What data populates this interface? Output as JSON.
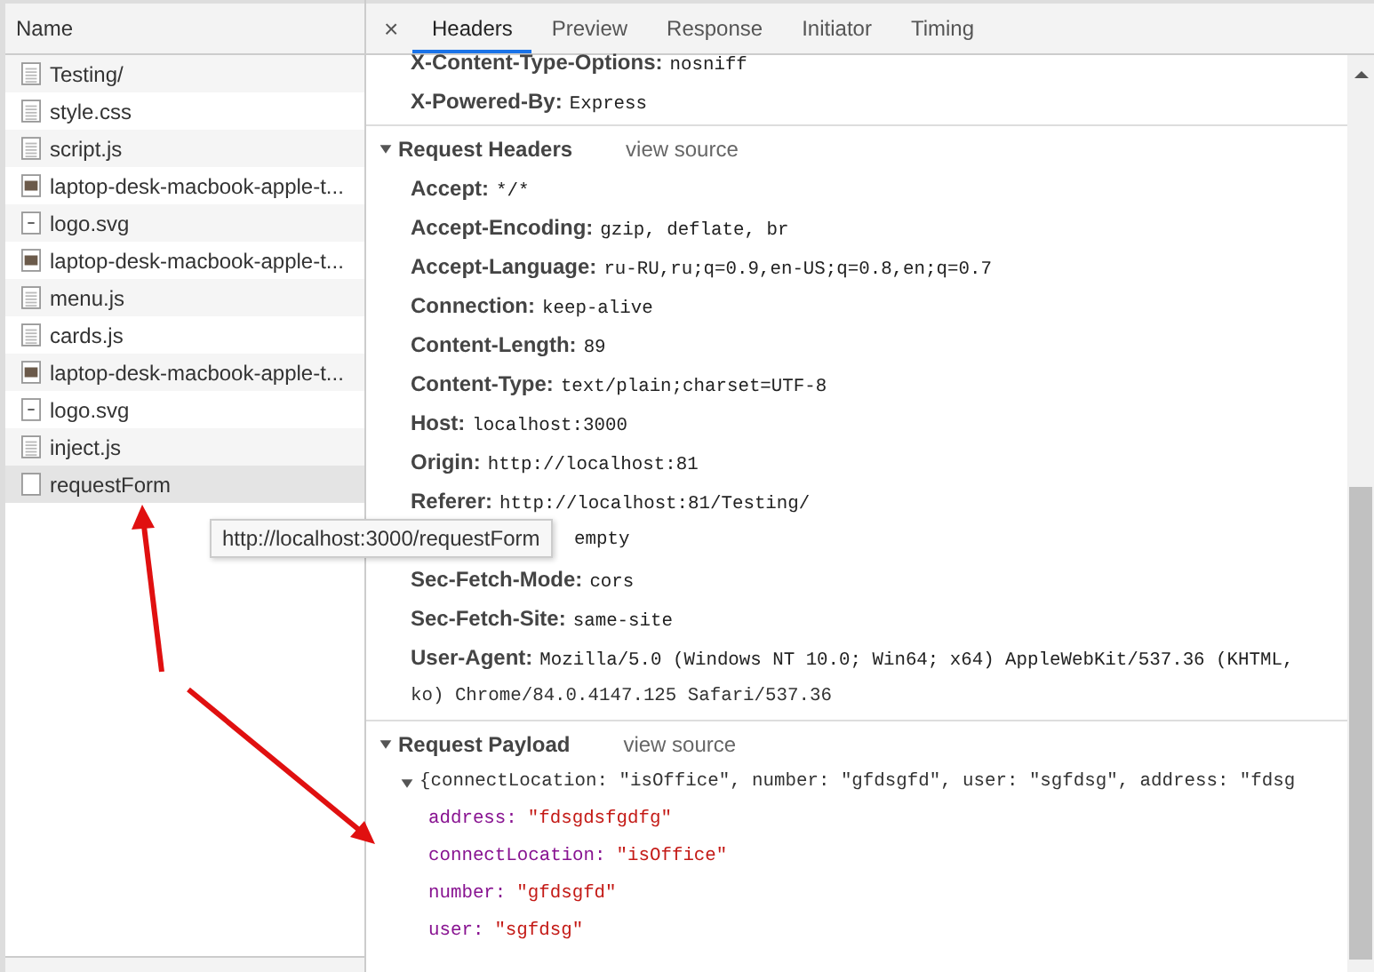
{
  "file_list": {
    "column": "Name",
    "items": [
      {
        "name": "Testing/",
        "kind": "doc",
        "selected": false
      },
      {
        "name": "style.css",
        "kind": "doc",
        "selected": false
      },
      {
        "name": "script.js",
        "kind": "doc",
        "selected": false
      },
      {
        "name": "laptop-desk-macbook-apple-t...",
        "kind": "image",
        "selected": false
      },
      {
        "name": "logo.svg",
        "kind": "svg",
        "selected": false
      },
      {
        "name": "laptop-desk-macbook-apple-t...",
        "kind": "image",
        "selected": false
      },
      {
        "name": "menu.js",
        "kind": "doc",
        "selected": false
      },
      {
        "name": "cards.js",
        "kind": "doc",
        "selected": false
      },
      {
        "name": "laptop-desk-macbook-apple-t...",
        "kind": "image",
        "selected": false
      },
      {
        "name": "logo.svg",
        "kind": "svg",
        "selected": false
      },
      {
        "name": "inject.js",
        "kind": "doc",
        "selected": false
      },
      {
        "name": "requestForm",
        "kind": "blank",
        "selected": true
      }
    ]
  },
  "tooltip": "http://localhost:3000/requestForm",
  "details": {
    "close": "×",
    "tabs": [
      {
        "label": "Headers",
        "selected": true
      },
      {
        "label": "Preview",
        "selected": false
      },
      {
        "label": "Response",
        "selected": false
      },
      {
        "label": "Initiator",
        "selected": false
      },
      {
        "label": "Timing",
        "selected": false
      }
    ],
    "response_headers": [
      {
        "name": "X-Content-Type-Options:",
        "value": "nosniff"
      },
      {
        "name": "X-Powered-By:",
        "value": "Express"
      }
    ],
    "request_headers": {
      "title": "Request Headers",
      "view_source": "view source",
      "expanded": true,
      "rows": [
        {
          "name": "Accept:",
          "value": "*/*"
        },
        {
          "name": "Accept-Encoding:",
          "value": "gzip, deflate, br"
        },
        {
          "name": "Accept-Language:",
          "value": "ru-RU,ru;q=0.9,en-US;q=0.8,en;q=0.7"
        },
        {
          "name": "Connection:",
          "value": "keep-alive"
        },
        {
          "name": "Content-Length:",
          "value": "89"
        },
        {
          "name": "Content-Type:",
          "value": "text/plain;charset=UTF-8"
        },
        {
          "name": "Host:",
          "value": "localhost:3000"
        },
        {
          "name": "Origin:",
          "value": "http://localhost:81"
        },
        {
          "name": "Referer:",
          "value": "http://localhost:81/Testing/"
        },
        {
          "value": "empty"
        },
        {
          "name": "Sec-Fetch-Mode:",
          "value": "cors"
        },
        {
          "name": "Sec-Fetch-Site:",
          "value": "same-site"
        },
        {
          "name": "User-Agent:",
          "value": "Mozilla/5.0 (Windows NT 10.0; Win64; x64) AppleWebKit/537.36 (KHTML,",
          "continuation": "ko) Chrome/84.0.4147.125 Safari/537.36"
        }
      ]
    },
    "request_payload": {
      "title": "Request Payload",
      "view_source": "view source",
      "expanded": true,
      "summary": "{connectLocation: \"isOffice\", number: \"gfdsgfd\", user: \"sgfdsg\", address: \"fdsg",
      "summary_expanded": true,
      "fields": [
        {
          "key": "address:",
          "value": "\"fdsgdsfgdfg\""
        },
        {
          "key": "connectLocation:",
          "value": "\"isOffice\""
        },
        {
          "key": "number:",
          "value": "\"gfdsgfd\""
        },
        {
          "key": "user:",
          "value": "\"sgfdsg\""
        }
      ]
    }
  }
}
